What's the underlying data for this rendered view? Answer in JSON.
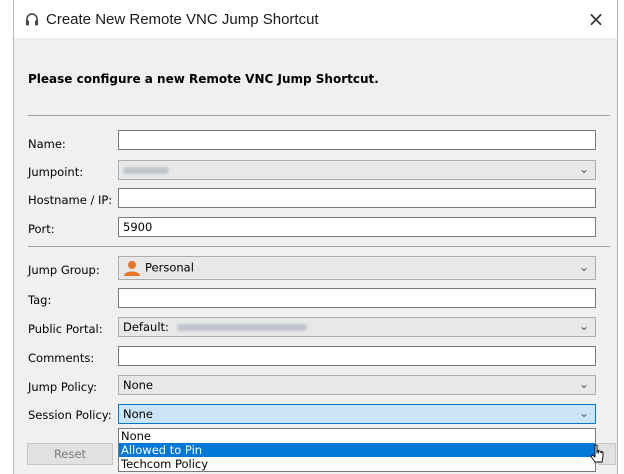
{
  "window": {
    "title": "Create New Remote VNC Jump Shortcut",
    "close_glyph": "×",
    "icon": "headset-icon"
  },
  "heading": "Please configure a new Remote VNC Jump Shortcut.",
  "fields": {
    "name": {
      "label": "Name:",
      "value": ""
    },
    "jumpoint": {
      "label": "Jumpoint:"
    },
    "hostname": {
      "label": "Hostname / IP:",
      "value": ""
    },
    "port": {
      "label": "Port:",
      "value": "5900"
    },
    "jump_group": {
      "label": "Jump Group:",
      "value": "Personal",
      "icon": "person-icon"
    },
    "tag": {
      "label": "Tag:",
      "value": ""
    },
    "public_portal": {
      "label": "Public Portal:",
      "value_prefix": "Default:"
    },
    "comments": {
      "label": "Comments:",
      "value": ""
    },
    "jump_policy": {
      "label": "Jump Policy:",
      "value": "None"
    },
    "session_policy": {
      "label": "Session Policy:",
      "value": "None",
      "options": [
        "None",
        "Allowed to Pin",
        "Techcom Policy"
      ],
      "highlighted": "Allowed to Pin"
    }
  },
  "buttons": {
    "reset": "Reset"
  },
  "colors": {
    "accent": "#0078d7",
    "selected_combo_bg": "#cce4f7",
    "dialog_bg": "#f0f0f0",
    "person_icon": "#e8742c"
  }
}
